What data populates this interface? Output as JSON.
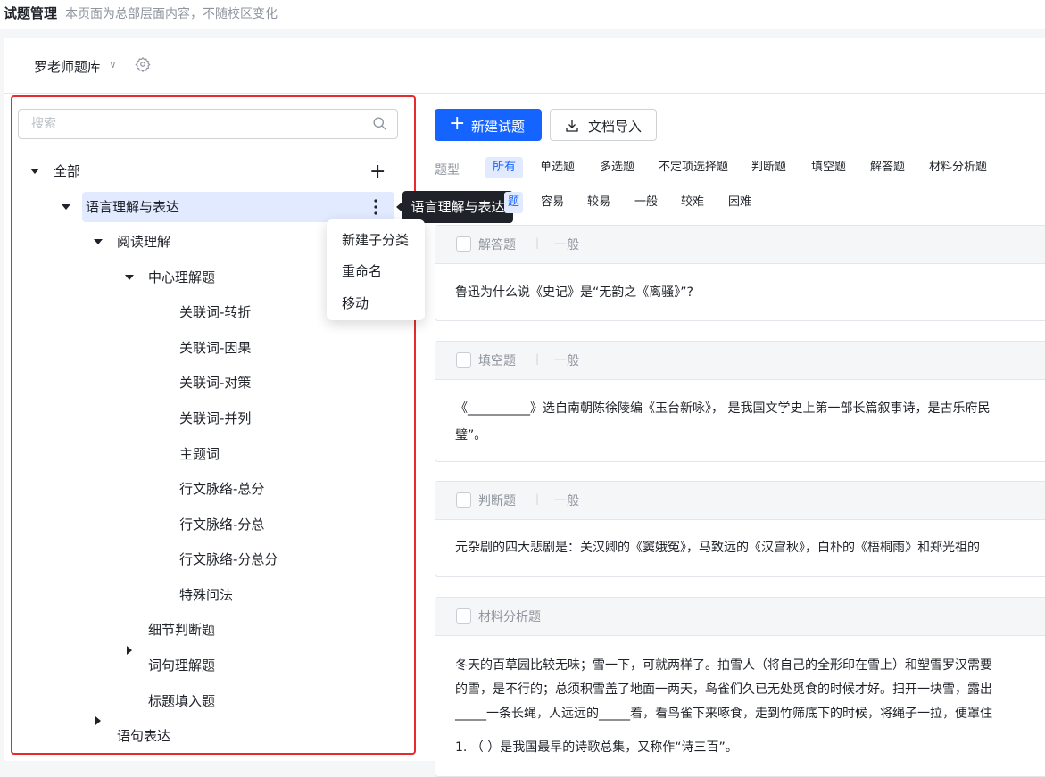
{
  "header": {
    "title": "试题管理",
    "subtitle": "本页面为总部层面内容，不随校区变化"
  },
  "bank": {
    "name": "罗老师题库"
  },
  "tree": {
    "search_placeholder": "搜索",
    "nodes": [
      {
        "label": "全部"
      },
      {
        "label": "语言理解与表达"
      },
      {
        "label": "阅读理解"
      },
      {
        "label": "中心理解题"
      },
      {
        "label": "关联词-转折"
      },
      {
        "label": "关联词-因果"
      },
      {
        "label": "关联词-对策"
      },
      {
        "label": "关联词-并列"
      },
      {
        "label": "主题词"
      },
      {
        "label": "行文脉络-总分"
      },
      {
        "label": "行文脉络-分总"
      },
      {
        "label": "行文脉络-分总分"
      },
      {
        "label": "特殊问法"
      },
      {
        "label": "细节判断题"
      },
      {
        "label": "词句理解题"
      },
      {
        "label": "标题填入题"
      },
      {
        "label": "语句表达"
      }
    ],
    "context_menu": [
      "新建子分类",
      "重命名",
      "移动"
    ],
    "tooltip": "语言理解与表达"
  },
  "toolbar": {
    "new_label": "新建试题",
    "import_label": "文档导入"
  },
  "filters": {
    "type_label": "题型",
    "types": [
      "所有",
      "单选题",
      "多选题",
      "不定项选择题",
      "判断题",
      "填空题",
      "解答题",
      "材料分析题"
    ],
    "difficulty_partial": "题",
    "difficulties": [
      "容易",
      "较易",
      "一般",
      "较难",
      "困难"
    ]
  },
  "questions": [
    {
      "type": "解答题",
      "level": "一般",
      "lines": [
        "鲁迅为什么说《史记》是“无韵之《离骚》”?"
      ]
    },
    {
      "type": "填空题",
      "level": "一般",
      "lines": [
        "《__________》选自南朝陈徐陵编《玉台新咏》， 是我国文学史上第一部长篇叙事诗，是古乐府民",
        "璧”。"
      ]
    },
    {
      "type": "判断题",
      "level": "一般",
      "lines": [
        "元杂剧的四大悲剧是：关汉卿的《窦娥冤》，马致远的《汉宫秋》，白朴的《梧桐雨》和郑光祖的"
      ]
    },
    {
      "type": "材料分析题",
      "level": "",
      "lines": [
        " 冬天的百草园比较无味；雪一下，可就两样了。拍雪人（将自己的全形印在雪上）和塑雪罗汉需要",
        "的雪，是不行的；总须积雪盖了地面一两天，鸟雀们久已无处觅食的时候才好。扫开一块雪，露出",
        "_____一条长绳，人远远的_____着，看鸟雀下来啄食，走到竹筛底下的时候，将绳子一拉，便罩住",
        "1.    （  ）是我国最早的诗歌总集，又称作“诗三百”。"
      ]
    }
  ],
  "colors": {
    "primary": "#1664ff",
    "highlight": "#e1eaff",
    "annotation": "#e52b2b"
  }
}
